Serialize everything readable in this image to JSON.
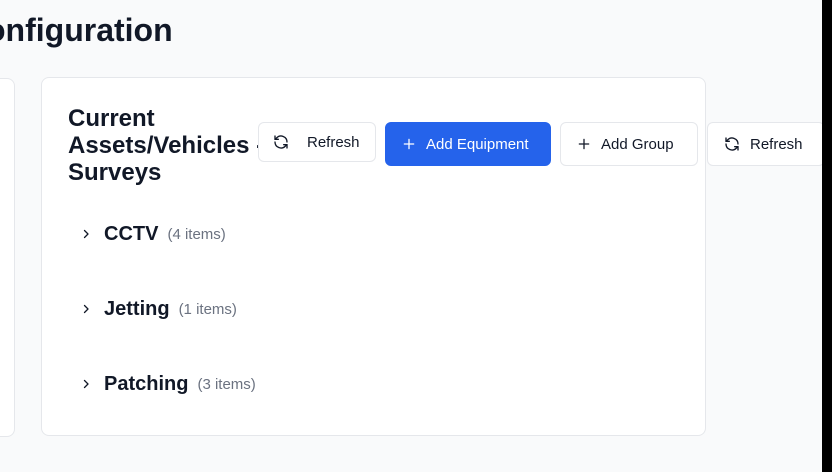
{
  "page": {
    "title": "onfiguration"
  },
  "card": {
    "title": "Current Assets/Vehicles - Surveys",
    "buttons": {
      "refresh_primary": "Refresh",
      "add_equipment": "Add Equipment",
      "add_group": "Add Group",
      "refresh_secondary": "Refresh"
    },
    "groups": [
      {
        "name": "CCTV",
        "count": "(4 items)"
      },
      {
        "name": "Jetting",
        "count": "(1 items)"
      },
      {
        "name": "Patching",
        "count": "(3 items)"
      }
    ]
  },
  "colors": {
    "accent": "#2563eb",
    "muted_text": "#6b7280",
    "border": "#e5e7eb"
  },
  "icons": {
    "refresh": "refresh-icon",
    "add": "plus-icon",
    "expand": "chevron-right-icon"
  }
}
